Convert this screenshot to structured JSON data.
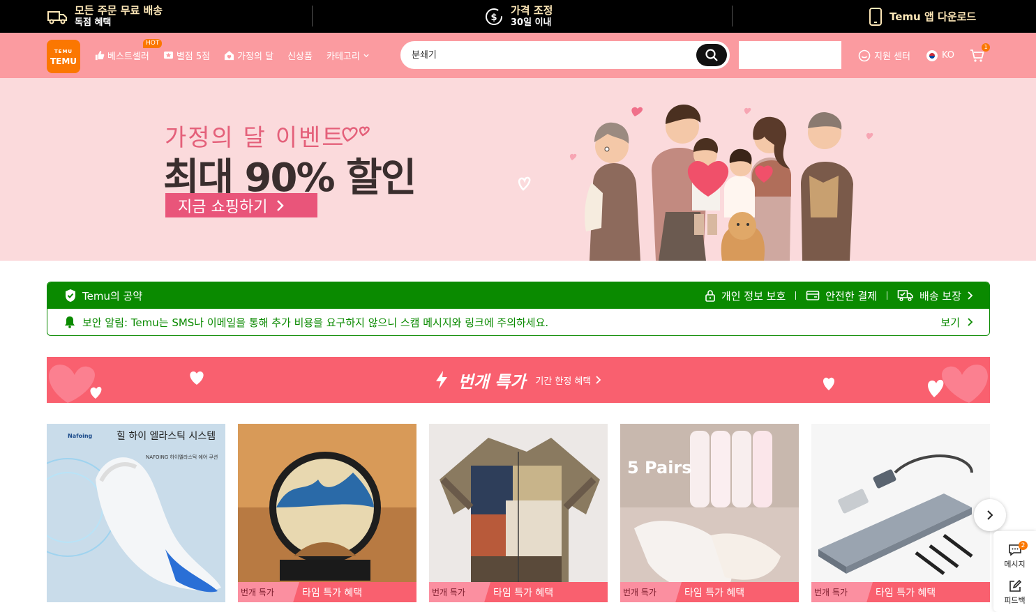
{
  "topbar": {
    "shipping": {
      "line1": "모든 주문 무료 배송",
      "line2": "독점 혜택"
    },
    "price": {
      "line1": "가격 조정",
      "line2": "30일 이내"
    },
    "app": {
      "label": "Temu 앱 다운로드"
    }
  },
  "header": {
    "logo_small": "TEMU",
    "logo_text": "TEMU",
    "nav": [
      {
        "label": "베스트셀러",
        "icon": "thumbs-up-icon",
        "badge": "HOT"
      },
      {
        "label": "별점 5점",
        "icon": "star-badge-icon"
      },
      {
        "label": "가정의 달",
        "icon": "house-heart-icon"
      },
      {
        "label": "신상품"
      },
      {
        "label": "카테고리",
        "icon": "chevron-down-icon"
      }
    ],
    "search_placeholder": "분쇄기",
    "support": "지원 센터",
    "language": "KO",
    "cart_count": "1"
  },
  "hero": {
    "subtitle": "가정의 달 이벤트",
    "title": "최대 90% 할인",
    "cta": "지금 쇼핑하기"
  },
  "promise": {
    "title": "Temu의 공약",
    "features": [
      "개인 정보 보호",
      "안전한 결제",
      "배송 보장"
    ],
    "alert": "보안 알림: Temu는 SMS나 이메일을 통해 추가 비용을 요구하지 않으니 스캠 메시지와 링크에 주의하세요.",
    "view": "보기"
  },
  "flash": {
    "title": "번개 특가",
    "subtitle": "기간 한정 혜택"
  },
  "products": [
    {
      "name": "insole",
      "brand": "Nafoing",
      "caption": "힐 하이 엘라스틱 시스템",
      "small": "NAFOING 하이엘라스틱 에어 쿠션"
    },
    {
      "name": "sand-art",
      "tag1": "번개 특가",
      "tag2": "타임 특가 혜택"
    },
    {
      "name": "shirt",
      "tag1": "번개 특가",
      "tag2": "타임 특가 혜택"
    },
    {
      "name": "socks",
      "overlay": "5 Pairs",
      "tag1": "번개 특가",
      "tag2": "타임 특가 혜택"
    },
    {
      "name": "usb-hub",
      "tag1": "번개 특가",
      "tag2": "타임 특가 혜택"
    }
  ],
  "side": {
    "message": "메시지",
    "message_count": "2",
    "feedback": "피드백"
  },
  "colors": {
    "header_bg": "#fb9ba0",
    "brand_orange": "#fb7701",
    "promise_green": "#0a8a00",
    "flash_red": "#f9606f",
    "hero_bg": "#fbdadc"
  }
}
